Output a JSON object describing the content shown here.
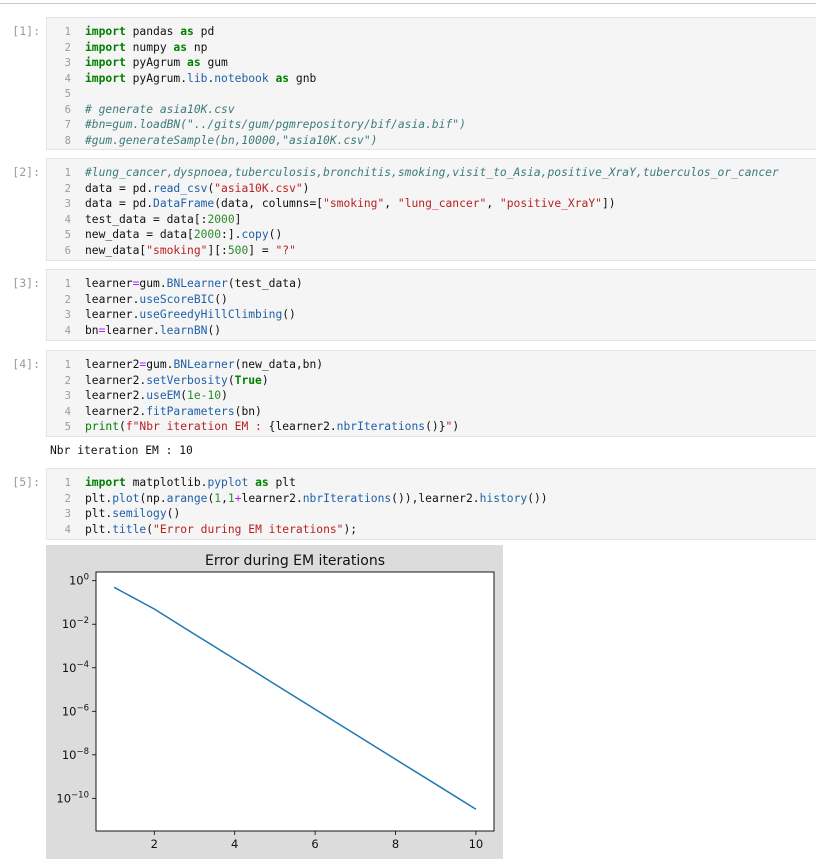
{
  "cells": [
    {
      "prompt": "[1]:",
      "lines": [
        {
          "n": "1",
          "html": "<span class=\"kw\">import</span> pandas <span class=\"kw\">as</span> pd"
        },
        {
          "n": "2",
          "html": "<span class=\"kw\">import</span> numpy <span class=\"kw\">as</span> np"
        },
        {
          "n": "3",
          "html": "<span class=\"kw\">import</span> pyAgrum <span class=\"kw\">as</span> gum"
        },
        {
          "n": "4",
          "html": "<span class=\"kw\">import</span> pyAgrum.<span class=\"at\">lib</span>.<span class=\"at\">notebook</span> <span class=\"kw\">as</span> gnb"
        },
        {
          "n": "5",
          "html": ""
        },
        {
          "n": "6",
          "html": "<span class=\"cm\"># generate asia10K.csv</span>"
        },
        {
          "n": "7",
          "html": "<span class=\"cm\">#bn=gum.loadBN(\"../gits/gum/pgmrepository/bif/asia.bif\")</span>"
        },
        {
          "n": "8",
          "html": "<span class=\"cm\">#gum.generateSample(bn,10000,\"asia10K.csv\")</span>"
        }
      ]
    },
    {
      "prompt": "[2]:",
      "lines": [
        {
          "n": "1",
          "html": "<span class=\"cm\">#lung_cancer,dyspnoea,tuberculosis,bronchitis,smoking,visit_to_Asia,positive_XraY,tuberculos_or_cancer</span>"
        },
        {
          "n": "2",
          "html": "data = pd.<span class=\"at\">read_csv</span>(<span class=\"st\">\"asia10K.csv\"</span>)"
        },
        {
          "n": "3",
          "html": "data = pd.<span class=\"at\">DataFrame</span>(data, columns=[<span class=\"st\">\"smoking\"</span>, <span class=\"st\">\"lung_cancer\"</span>, <span class=\"st\">\"positive_XraY\"</span>])"
        },
        {
          "n": "4",
          "html": "test_data = data[:<span class=\"no\">2000</span>]"
        },
        {
          "n": "5",
          "html": "new_data = data[<span class=\"no\">2000</span>:].<span class=\"at\">copy</span>()"
        },
        {
          "n": "6",
          "html": "new_data[<span class=\"st\">\"smoking\"</span>][:<span class=\"no\">500</span>] = <span class=\"st\">\"?\"</span>"
        }
      ]
    },
    {
      "prompt": "[3]:",
      "lines": [
        {
          "n": "1",
          "html": "learner<span class=\"op\">=</span>gum.<span class=\"at\">BNLearner</span>(test_data)"
        },
        {
          "n": "2",
          "html": "learner.<span class=\"at\">useScoreBIC</span>()"
        },
        {
          "n": "3",
          "html": "learner.<span class=\"at\">useGreedyHillClimbing</span>()"
        },
        {
          "n": "4",
          "html": "bn<span class=\"op\">=</span>learner.<span class=\"at\">learnBN</span>()"
        }
      ]
    },
    {
      "prompt": "[4]:",
      "lines": [
        {
          "n": "1",
          "html": "learner2<span class=\"op\">=</span>gum.<span class=\"at\">BNLearner</span>(new_data,bn)"
        },
        {
          "n": "2",
          "html": "learner2.<span class=\"at\">setVerbosity</span>(<span class=\"kw\">True</span>)"
        },
        {
          "n": "3",
          "html": "learner2.<span class=\"at\">useEM</span>(<span class=\"no\">1e-10</span>)"
        },
        {
          "n": "4",
          "html": "learner2.<span class=\"at\">fitParameters</span>(bn)"
        },
        {
          "n": "5",
          "html": "<span class=\"bi\">print</span>(<span class=\"st\">f\"Nbr iteration EM : </span>{learner2.<span class=\"at\">nbrIterations</span>()}<span class=\"st\">\"</span>)"
        }
      ],
      "output": "Nbr iteration EM : 10"
    },
    {
      "prompt": "[5]:",
      "lines": [
        {
          "n": "1",
          "html": "<span class=\"kw\">import</span> matplotlib.<span class=\"at\">pyplot</span> <span class=\"kw\">as</span> plt"
        },
        {
          "n": "2",
          "html": "plt.<span class=\"at\">plot</span>(np.<span class=\"at\">arange</span>(<span class=\"no\">1</span>,<span class=\"no\">1</span><span class=\"op\">+</span>learner2.<span class=\"at\">nbrIterations</span>()),learner2.<span class=\"at\">history</span>())"
        },
        {
          "n": "3",
          "html": "plt.<span class=\"at\">semilogy</span>()"
        },
        {
          "n": "4",
          "html": "plt.<span class=\"at\">title</span>(<span class=\"st\">\"Error during EM iterations\"</span>);"
        }
      ]
    }
  ],
  "chart_data": {
    "type": "line",
    "title": "Error during EM iterations",
    "xlabel": "",
    "ylabel": "",
    "yscale": "log",
    "xlim": [
      0.55,
      10.45
    ],
    "ylim_log10": [
      -11.5,
      0.4
    ],
    "x_ticks": [
      "2",
      "4",
      "6",
      "8",
      "10"
    ],
    "x_tick_values": [
      2,
      4,
      6,
      8,
      10
    ],
    "y_tick_exponents": [
      "0",
      "-2",
      "-4",
      "-6",
      "-8",
      "-10"
    ],
    "y_tick_values_log10": [
      0,
      -2,
      -4,
      -6,
      -8,
      -10
    ],
    "line_color": "#1f77b4",
    "series": [
      {
        "x": [
          1,
          2,
          3,
          4,
          5,
          6,
          7,
          8,
          9,
          10
        ],
        "y": [
          0.5,
          0.05,
          0.0035,
          0.00025,
          1.75e-05,
          1.25e-06,
          8.75e-08,
          6.25e-09,
          4.45e-10,
          3.15e-11
        ]
      }
    ]
  }
}
